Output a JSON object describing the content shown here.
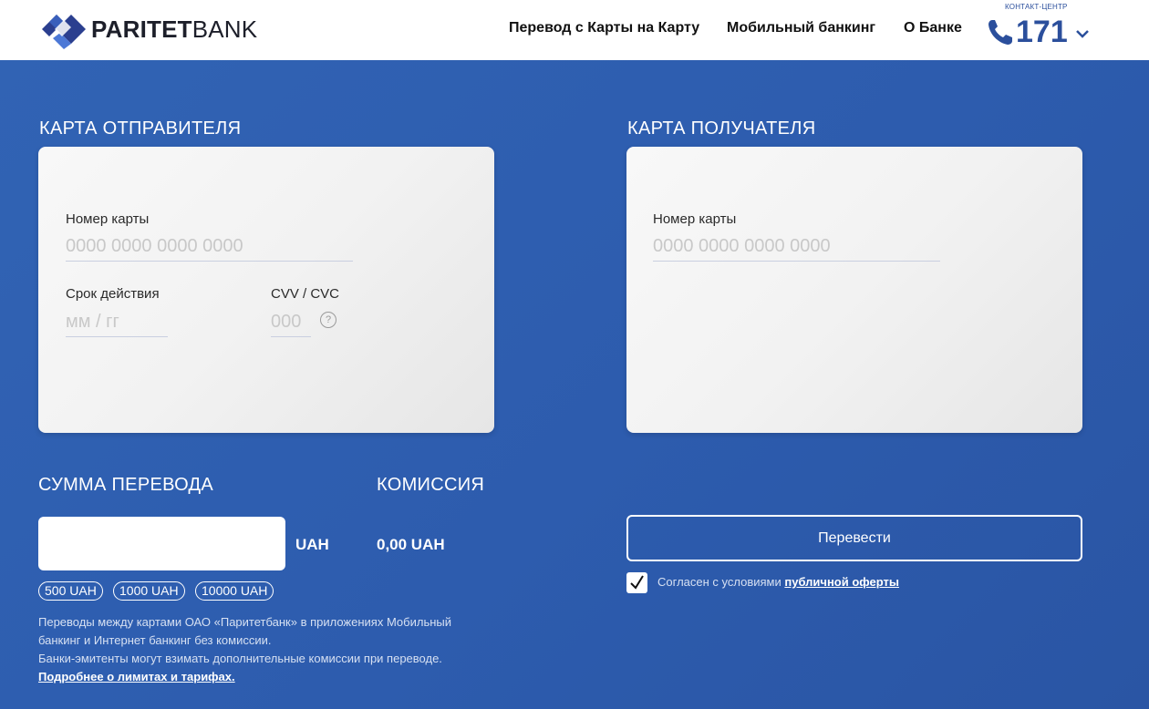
{
  "header": {
    "logo": {
      "brand_bold": "PARITET",
      "brand_light": "BANK",
      "icon": "paritetbank-diamond-logo"
    },
    "nav": [
      {
        "label": "Перевод с Карты на Карту"
      },
      {
        "label": "Мобильный банкинг"
      },
      {
        "label": "О Банке"
      }
    ],
    "contact": {
      "label": "КОНТАКТ-ЦЕНТР",
      "phone": "171",
      "icon": "phone-icon",
      "dropdown_icon": "chevron-down-icon"
    }
  },
  "sender_card": {
    "title": "КАРТА ОТПРАВИТЕЛЯ",
    "card_number": {
      "label": "Номер карты",
      "placeholder": "0000 0000 0000 0000",
      "value": ""
    },
    "expiry": {
      "label": "Срок действия",
      "placeholder": "мм / гг",
      "value": ""
    },
    "cvv": {
      "label": "CVV / CVC",
      "placeholder": "000",
      "value": "",
      "help_icon": "question-circle-icon",
      "help_glyph": "?"
    }
  },
  "receiver_card": {
    "title": "КАРТА ПОЛУЧАТЕЛЯ",
    "card_number": {
      "label": "Номер карты",
      "placeholder": "0000 0000 0000 0000",
      "value": ""
    }
  },
  "amount": {
    "title": "СУММА ПЕРЕВОДА",
    "value": "",
    "currency": "UAH",
    "presets": [
      "500 UAH",
      "1000 UAH",
      "10000 UAH"
    ]
  },
  "commission": {
    "title": "КОМИССИЯ",
    "value": "0,00 UAH"
  },
  "notes": {
    "line1": "Переводы между картами ОАО «Паритетбанк» в приложениях Мобильный",
    "line2": "банкинг и Интернет банкинг без комиссии.",
    "line3": "Банки-эмитенты могут взимать дополнительные комиссии при переводе.",
    "link": "Подробнее о лимитах и тарифах."
  },
  "actions": {
    "transfer_label": "Перевести",
    "agree_text": "Согласен с условиями ",
    "agree_link": "публичной оферты",
    "agree_checked": true
  },
  "colors": {
    "background": "#2f5fb0",
    "brand_blue": "#2b4f9c",
    "card": "#f2f2f2",
    "white": "#ffffff"
  }
}
